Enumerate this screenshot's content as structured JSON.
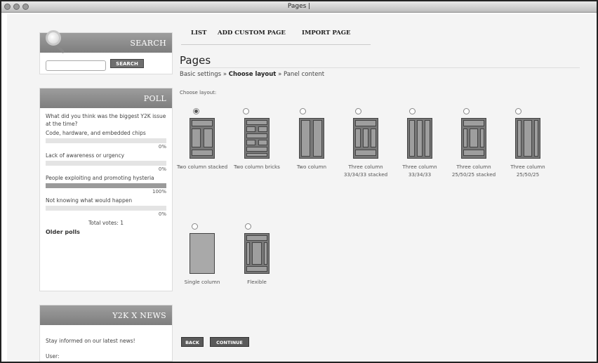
{
  "window": {
    "title": "Pages |"
  },
  "sidebar": {
    "search": {
      "heading": "SEARCH",
      "button_label": "SEARCH",
      "input_value": ""
    },
    "poll": {
      "heading": "POLL",
      "question": "What did you think was the biggest Y2K issue at the time?",
      "options": [
        {
          "label": "Code, hardware, and embedded chips",
          "percent": "0%",
          "fraction": 0.0
        },
        {
          "label": "Lack of awareness or urgency",
          "percent": "0%",
          "fraction": 0.0
        },
        {
          "label": "People exploiting and promoting hysteria",
          "percent": "100%",
          "fraction": 1.0
        },
        {
          "label": "Not knowing what would happen",
          "percent": "0%",
          "fraction": 0.0
        }
      ],
      "total_votes": "Total votes: 1",
      "older_polls": "Older polls"
    },
    "news": {
      "heading": "Y2K X NEWS",
      "text": "Stay informed on our latest news!",
      "user_label": "User:"
    }
  },
  "tabs": [
    "LIST",
    "ADD CUSTOM PAGE",
    "IMPORT PAGE"
  ],
  "main": {
    "title": "Pages",
    "breadcrumb": {
      "step1": "Basic settings",
      "sep": "»",
      "step2": "Choose layout",
      "step3": "Panel content"
    },
    "choose_label": "Choose layout:",
    "layouts": [
      {
        "label": "Two column stacked",
        "selected": true
      },
      {
        "label": "Two column bricks",
        "selected": false
      },
      {
        "label": "Two column",
        "selected": false
      },
      {
        "label": "Three column 33/34/33 stacked",
        "selected": false
      },
      {
        "label": "Three column 33/34/33",
        "selected": false
      },
      {
        "label": "Three column 25/50/25 stacked",
        "selected": false
      },
      {
        "label": "Three column 25/50/25",
        "selected": false
      },
      {
        "label": "Single column",
        "selected": false
      },
      {
        "label": "Flexible",
        "selected": false
      }
    ],
    "buttons": {
      "back": "BACK",
      "continue": "CONTINUE"
    }
  }
}
